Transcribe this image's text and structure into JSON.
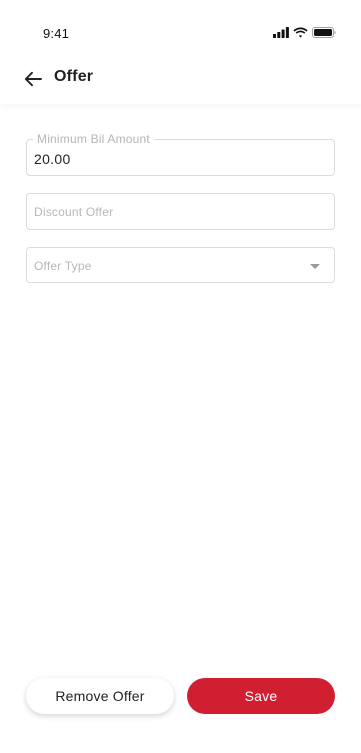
{
  "status_bar": {
    "time": "9:41",
    "icons": [
      "signal-icon",
      "wifi-icon",
      "battery-icon"
    ]
  },
  "header": {
    "title": "Offer",
    "back_icon": "arrow-left-icon"
  },
  "form": {
    "minimum_bill": {
      "label": "Minimum Bil Amount",
      "value": "20.00"
    },
    "discount_offer": {
      "placeholder": "Discount Offer",
      "value": ""
    },
    "offer_type": {
      "placeholder": "Offer Type",
      "icon": "caret-down-icon"
    }
  },
  "actions": {
    "remove_label": "Remove Offer",
    "save_label": "Save"
  },
  "colors": {
    "primary": "#cf1f30",
    "border": "#dcdcdc",
    "placeholder": "#b8b8b8"
  }
}
